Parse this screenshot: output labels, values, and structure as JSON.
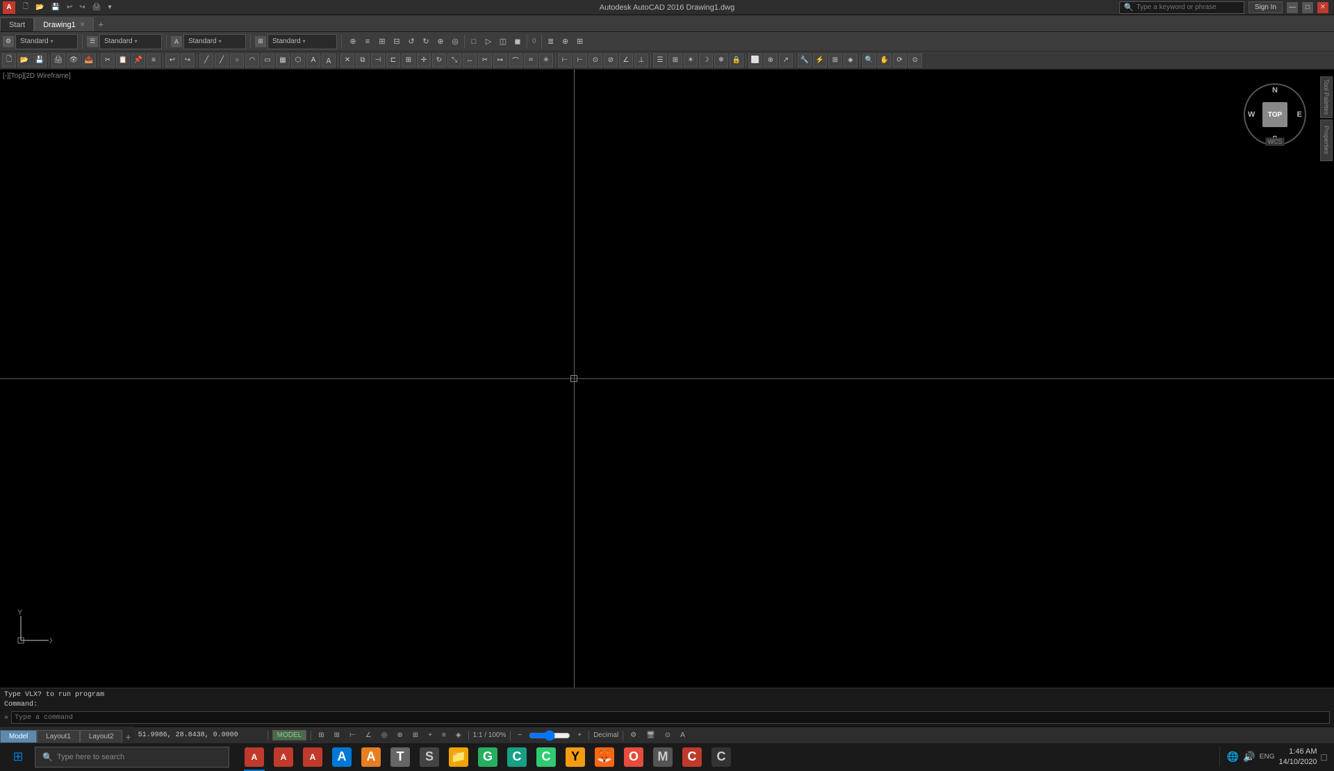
{
  "app": {
    "title": "Autodesk AutoCAD 2016  Drawing1.dwg",
    "tabs": [
      {
        "label": "Start",
        "active": false
      },
      {
        "label": "Drawing1",
        "active": true
      }
    ]
  },
  "toolbar": {
    "workspace_dropdown": "Standard",
    "layers_dropdown": "Standard",
    "annotationdrop": "Standard",
    "scaledrop": "Standard",
    "coord_display": "51.9986, 28.8438, 0.0000",
    "model_label": "MODEL",
    "scale_label": "1:1 / 100%",
    "decimal_label": "Decimal"
  },
  "viewport": {
    "label": "[-][Top][2D Wireframe]",
    "compass_top": "N",
    "compass_bottom": "S",
    "compass_left": "W",
    "compass_right": "E",
    "compass_center": "TOP",
    "wcs_label": "WCS"
  },
  "command": {
    "output_line1": "Type VLX? to run program",
    "output_line2": "Command:",
    "prompt": "»",
    "input_placeholder": "Type a command"
  },
  "layout_tabs": [
    {
      "label": "Model",
      "active": true
    },
    {
      "label": "Layout1",
      "active": false
    },
    {
      "label": "Layout2",
      "active": false
    }
  ],
  "title_search": {
    "placeholder": "Type a keyword or phrase"
  },
  "title_buttons": {
    "sign_in": "Sign In",
    "help": "?"
  },
  "taskbar": {
    "search_placeholder": "Type here to search",
    "clock_time": "1:46 AM",
    "clock_date": "14/10/2020",
    "language": "ENG",
    "apps": [
      {
        "name": "Windows",
        "icon": "⊞",
        "color": "windows"
      },
      {
        "name": "AutoCAD Red 1",
        "letter": "A",
        "color": "autocad-red"
      },
      {
        "name": "AutoCAD Red 2",
        "letter": "A",
        "color": "autocad-red"
      },
      {
        "name": "AutoCAD Red 3",
        "letter": "A",
        "color": "autocad-red"
      },
      {
        "name": "AutoCAD Blue",
        "letter": "A",
        "color": "blue"
      },
      {
        "name": "AutoCAD Orange",
        "letter": "A",
        "color": "orange"
      },
      {
        "name": "Tool T",
        "letter": "T",
        "color": "gray"
      },
      {
        "name": "App S",
        "letter": "S",
        "color": "gray"
      },
      {
        "name": "File Explorer",
        "letter": "📁",
        "color": "yellow"
      },
      {
        "name": "App G",
        "letter": "G",
        "color": "green"
      },
      {
        "name": "App C1",
        "letter": "C",
        "color": "teal"
      },
      {
        "name": "App C2",
        "letter": "C",
        "color": "green"
      },
      {
        "name": "App Y",
        "letter": "Y",
        "color": "yellow"
      },
      {
        "name": "Firefox",
        "letter": "🦊",
        "color": "orange"
      },
      {
        "name": "App O",
        "letter": "O",
        "color": "red"
      },
      {
        "name": "App M",
        "letter": "M",
        "color": "gray"
      },
      {
        "name": "App C3",
        "letter": "C",
        "color": "red"
      },
      {
        "name": "App Cr",
        "letter": "C",
        "color": "gray"
      }
    ]
  }
}
